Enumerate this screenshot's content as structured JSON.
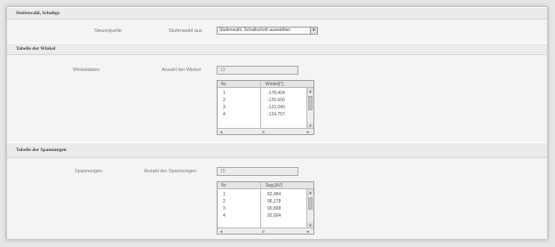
{
  "sections": {
    "settings": {
      "title": "Stufenwahl, Schaltge",
      "row_label": "Steuerquelle",
      "field_label": "Stufenwahl aus",
      "select_value": "Stufenwahl, Schaltschritt auswählen"
    },
    "angles": {
      "title": "Tabelle der Winkel",
      "row_label": "Winkeldaten",
      "count_label": "Anzahl der Winkel",
      "count_value": "13",
      "columns": [
        "Nr.",
        "Winkel[°]"
      ],
      "rows": [
        [
          "1",
          "-178,404"
        ],
        [
          "2",
          "-120,600"
        ],
        [
          "3",
          "-122,040"
        ],
        [
          "4",
          "-124,757"
        ]
      ]
    },
    "voltages": {
      "title": "Tabelle der Spannungen",
      "row_label": "Spannungen",
      "count_label": "Anzahl der Spannungen",
      "count_value": "15",
      "columns": [
        "Nr.",
        "Spg.[kV]"
      ],
      "rows": [
        [
          "1",
          "82,484"
        ],
        [
          "2",
          "96,178"
        ],
        [
          "3",
          "90,868"
        ],
        [
          "4",
          "92,664"
        ]
      ]
    }
  },
  "scroll_glyphs": {
    "up": "▲",
    "down": "▼",
    "left": "◄",
    "right": "►",
    "center": "III",
    "dropdown": "▾"
  }
}
